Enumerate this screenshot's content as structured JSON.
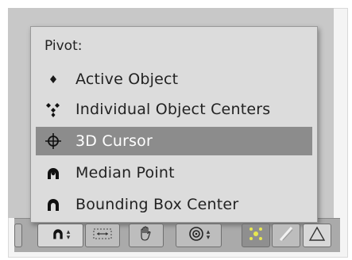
{
  "pivot_menu": {
    "title": "Pivot:",
    "items": [
      {
        "label": "Active Object",
        "icon": "active-object-icon",
        "selected": false
      },
      {
        "label": "Individual Object Centers",
        "icon": "individual-centers-icon",
        "selected": false
      },
      {
        "label": "3D Cursor",
        "icon": "3d-cursor-icon",
        "selected": true
      },
      {
        "label": "Median Point",
        "icon": "median-point-icon",
        "selected": false
      },
      {
        "label": "Bounding Box Center",
        "icon": "bounding-box-center-icon",
        "selected": false
      }
    ]
  },
  "header_toolbar": {
    "buttons": [
      "pivot-point-icon",
      "transform-orientation-icon",
      "grab-hand-icon",
      "proportional-edit-icon",
      "snap-icon",
      "manipulator-translate-icon",
      "manipulator-scale-icon"
    ]
  },
  "colors": {
    "menu_bg": "#dcdcdc",
    "highlight": "#8c8c8c",
    "header_bg": "#aaaaaa"
  }
}
